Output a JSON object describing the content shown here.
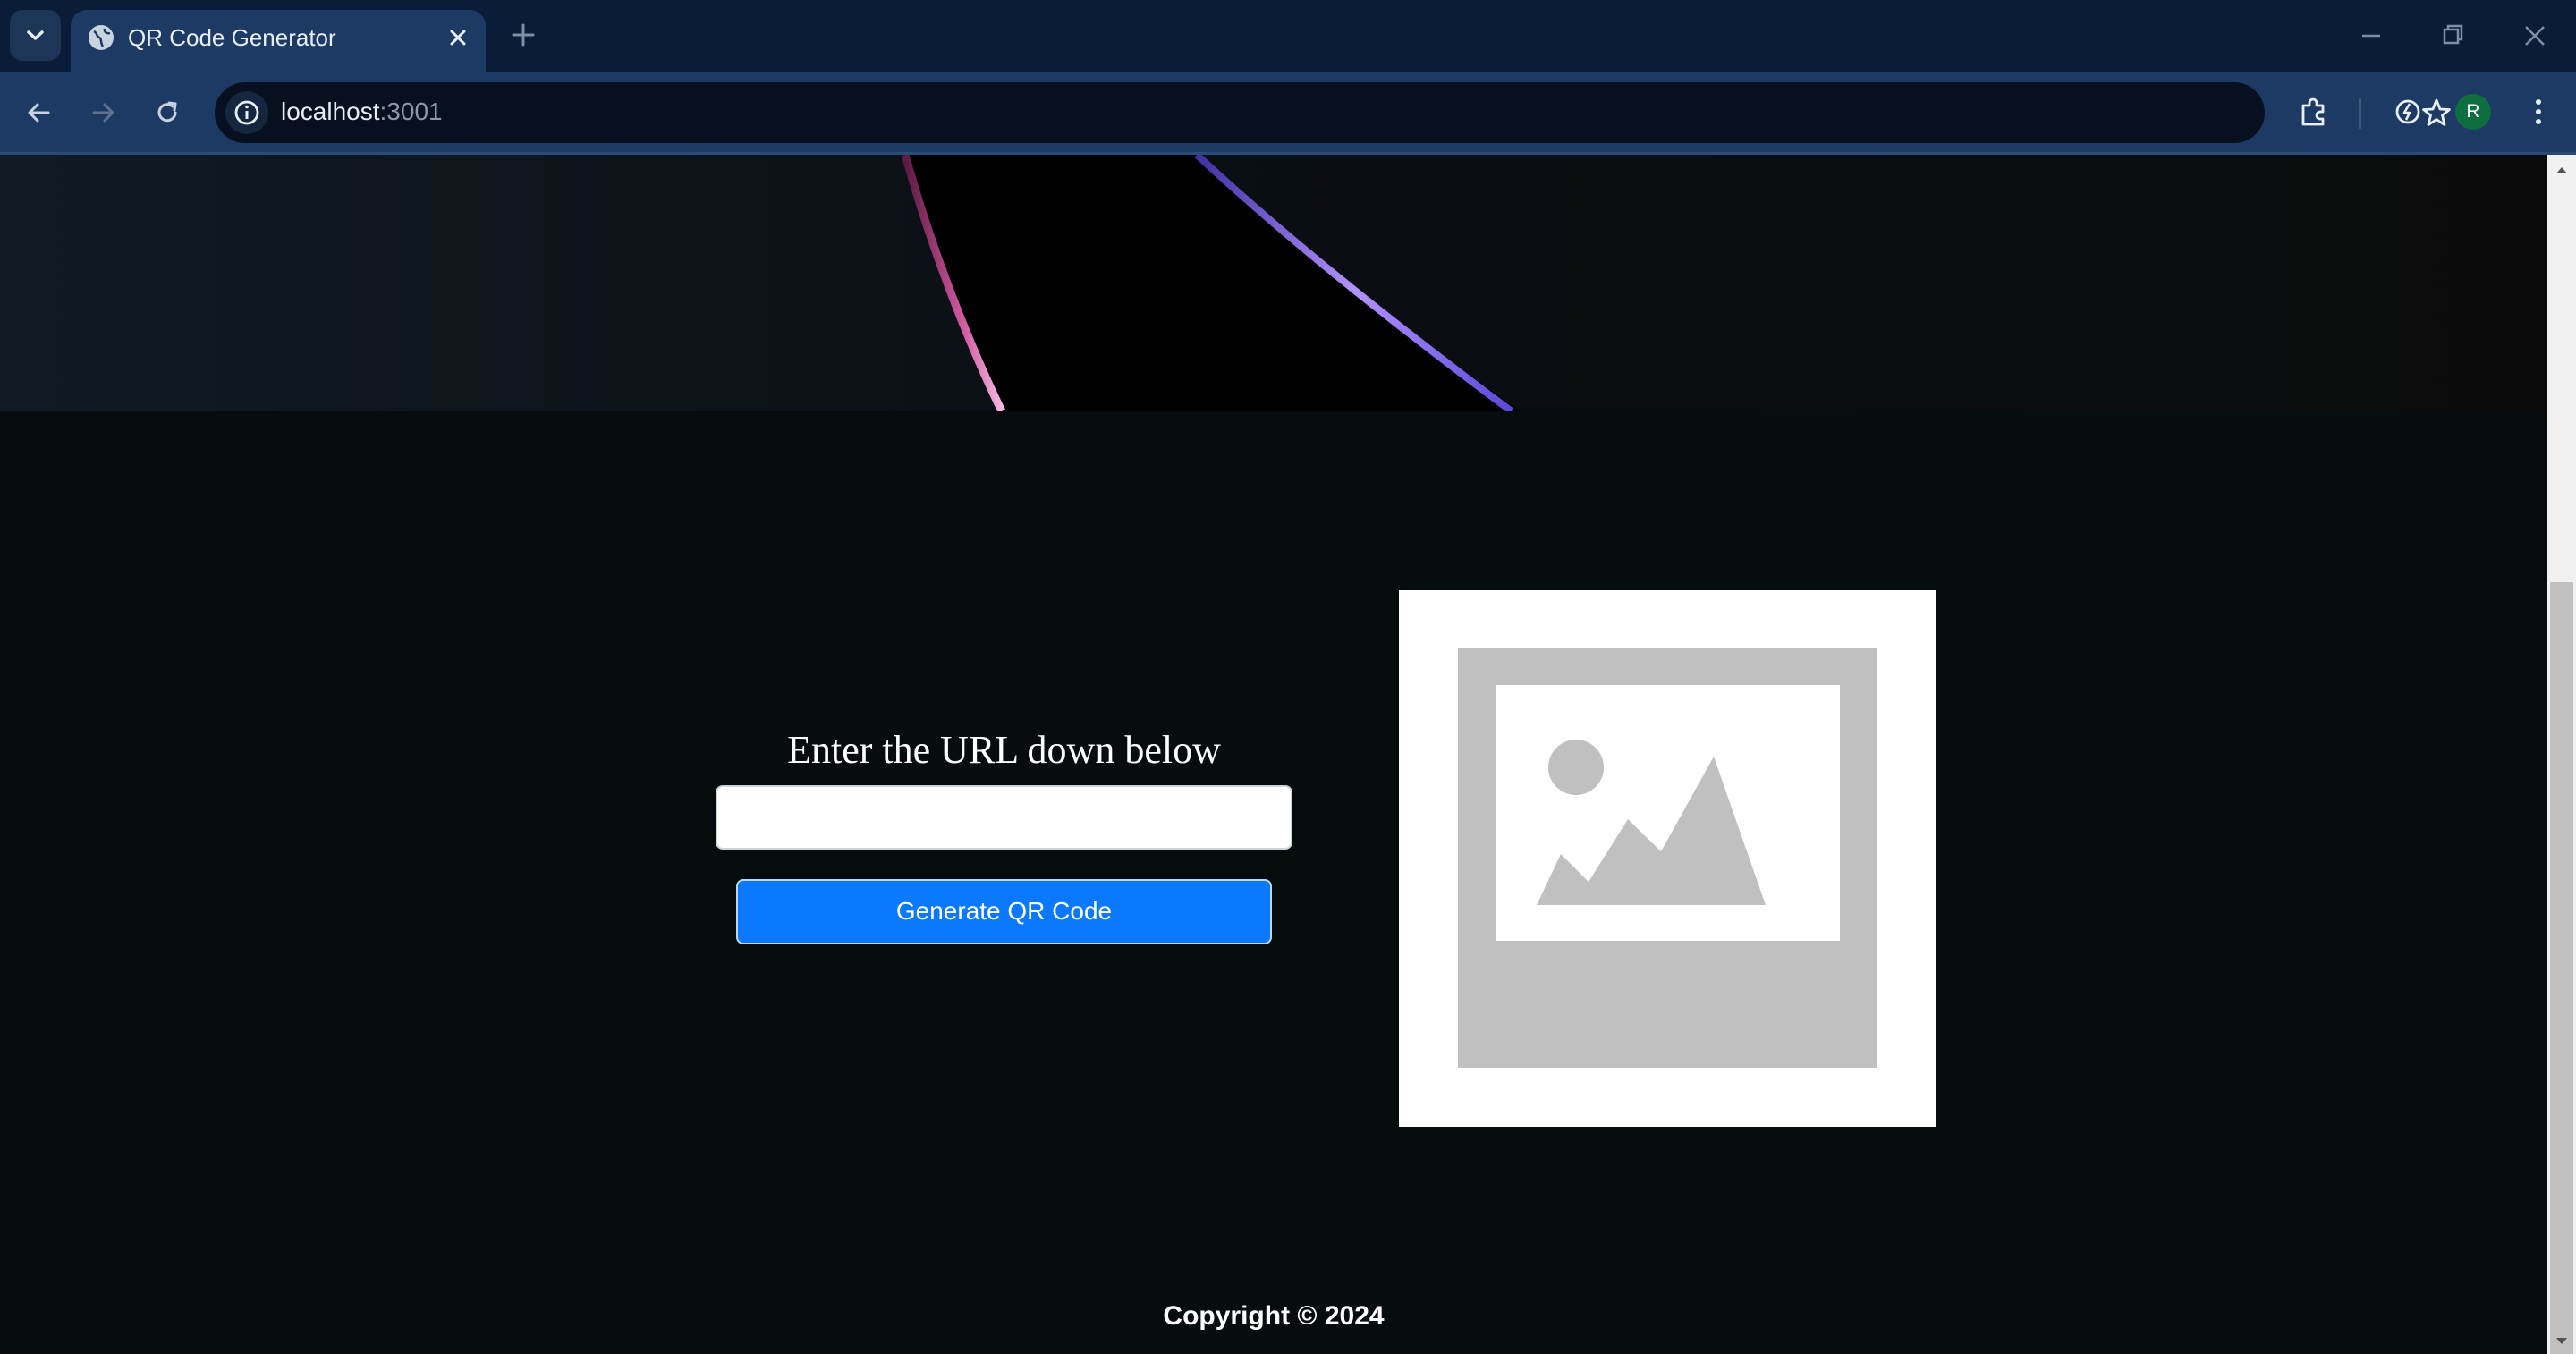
{
  "browser": {
    "tab_title": "QR Code Generator",
    "url_host": "localhost",
    "url_port": ":3001",
    "profile_initial": "R",
    "icons": [
      "tab-search-icon",
      "globe-icon",
      "close-icon",
      "plus-icon",
      "minimize-icon",
      "restore-icon",
      "window-close-icon",
      "back-arrow-icon",
      "forward-arrow-icon",
      "reload-icon",
      "info-icon",
      "star-icon",
      "extensions-icon",
      "performance-icon",
      "menu-dots-icon"
    ]
  },
  "main": {
    "prompt": "Enter the URL down below",
    "url_input_value": "",
    "generate_button_label": "Generate QR Code",
    "image_placeholder_icon": "image-placeholder-icon"
  },
  "footer": {
    "copyright": "Copyright © 2024"
  },
  "colors": {
    "page_background": "#070d0e",
    "button_accent": "#0a78ff",
    "tabstrip": "#0a1c36",
    "toolbar": "#1c3a64"
  }
}
